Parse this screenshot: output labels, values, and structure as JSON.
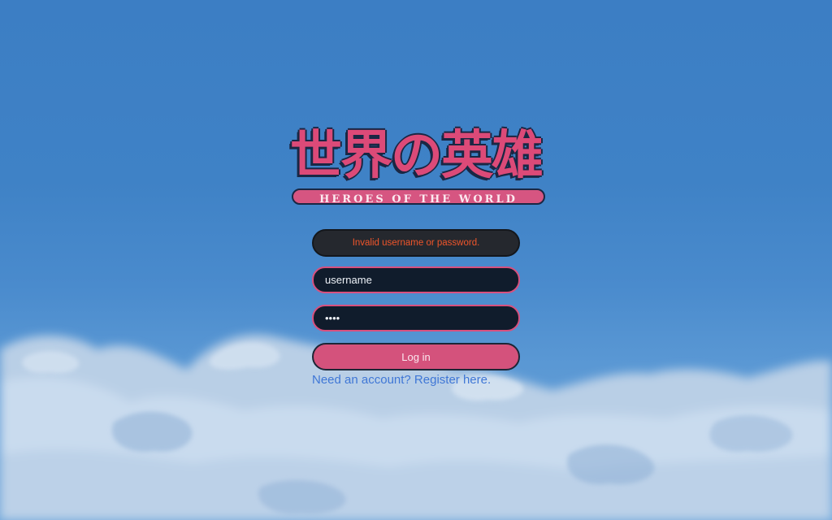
{
  "logo": {
    "kanji": "世界の英雄",
    "subtitle": "HEROES OF THE WORLD"
  },
  "login": {
    "error_message": "Invalid username or password.",
    "username_value": "username",
    "password_value": "••••",
    "login_button_label": "Log in",
    "register_link_text": "Need an account? Register here."
  },
  "colors": {
    "accent_pink": "#d4527c",
    "field_bg": "#101c2c",
    "error_text": "#f0552a",
    "link_blue": "#3f77d6",
    "sky_blue": "#3f82c6"
  }
}
